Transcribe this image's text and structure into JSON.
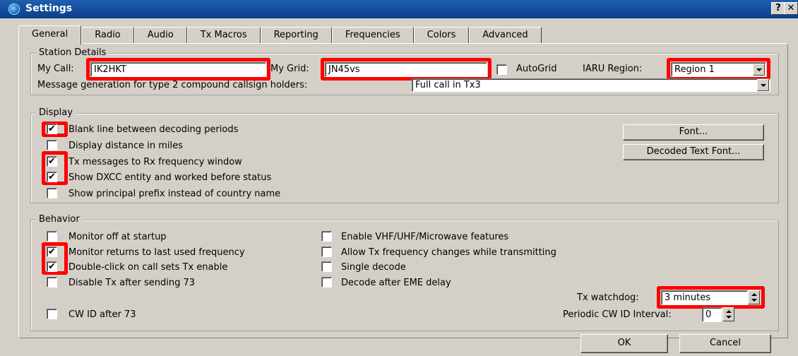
{
  "window": {
    "title": "Settings",
    "help_glyph": "?",
    "close_glyph": "✕",
    "icon": "globe-icon"
  },
  "tabs": [
    {
      "label": "General",
      "active": true
    },
    {
      "label": "Radio"
    },
    {
      "label": "Audio"
    },
    {
      "label": "Tx Macros"
    },
    {
      "label": "Reporting"
    },
    {
      "label": "Frequencies"
    },
    {
      "label": "Colors"
    },
    {
      "label": "Advanced"
    }
  ],
  "station": {
    "title": "Station Details",
    "my_call_label": "My Call:",
    "my_call_value": "IK2HKT",
    "my_grid_label": "My Grid:",
    "my_grid_value": "JN45vs",
    "autogrid_label": "AutoGrid",
    "autogrid_checked": false,
    "iaru_label": "IARU Region:",
    "iaru_value": "Region 1",
    "msg_gen_label": "Message generation for type 2 compound callsign holders:",
    "msg_gen_value": "Full call in Tx3"
  },
  "display": {
    "title": "Display",
    "options": [
      {
        "label": "Blank line between decoding periods",
        "checked": true
      },
      {
        "label": "Display distance in miles",
        "checked": false
      },
      {
        "label": "Tx messages to Rx frequency window",
        "checked": true
      },
      {
        "label": "Show DXCC entity and worked before status",
        "checked": true
      },
      {
        "label": "Show principal prefix instead of country name",
        "checked": false
      }
    ],
    "font_button": "Font...",
    "decoded_font_button": "Decoded Text Font..."
  },
  "behavior": {
    "title": "Behavior",
    "left_options": [
      {
        "label": "Monitor off at startup",
        "checked": false
      },
      {
        "label": "Monitor returns to last used frequency",
        "checked": true
      },
      {
        "label": "Double-click on call sets Tx enable",
        "checked": true
      },
      {
        "label": "Disable Tx after sending 73",
        "checked": false
      }
    ],
    "right_options": [
      {
        "label": "Enable VHF/UHF/Microwave features",
        "checked": false
      },
      {
        "label": "Allow Tx frequency changes while transmitting",
        "checked": false
      },
      {
        "label": "Single decode",
        "checked": false
      },
      {
        "label": "Decode after EME delay",
        "checked": false
      }
    ],
    "cw_id_label": "CW ID after 73",
    "cw_id_checked": false,
    "tx_watchdog_label": "Tx watchdog:",
    "tx_watchdog_value": "3 minutes",
    "periodic_cw_label": "Periodic CW ID Interval:",
    "periodic_cw_value": "0"
  },
  "footer": {
    "ok_label": "OK",
    "cancel_label": "Cancel"
  },
  "colors": {
    "highlight": "#ff0000",
    "dialog_bg": "#d4d0c8",
    "titlebar": "#0a3d8a"
  }
}
